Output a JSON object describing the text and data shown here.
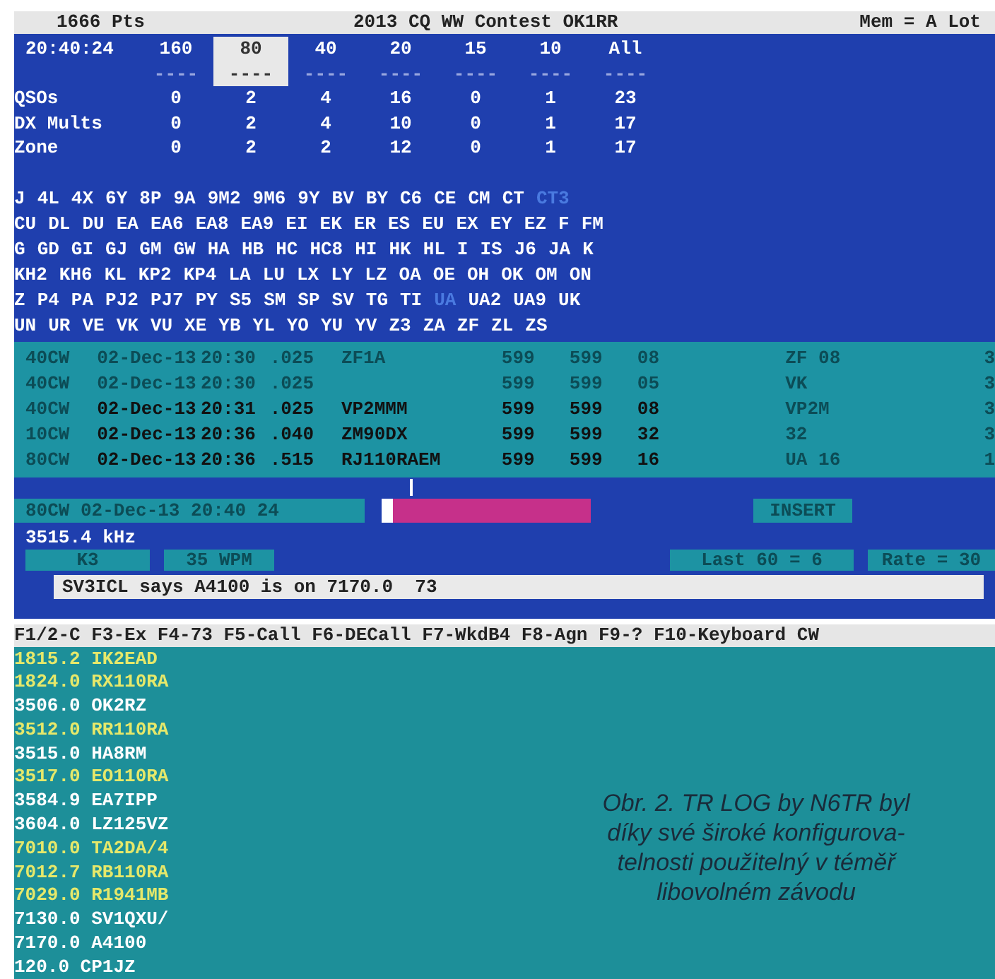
{
  "header": {
    "score": "1666 Pts",
    "title": "2013 CQ WW Contest OK1RR",
    "memory": "Mem = A Lot"
  },
  "stats": {
    "time": "20:40:24",
    "bands": [
      {
        "label": "160",
        "dashes": "----",
        "selected": false
      },
      {
        "label": "80",
        "dashes": "----",
        "selected": true
      },
      {
        "label": "40",
        "dashes": "----",
        "selected": false
      },
      {
        "label": "20",
        "dashes": "----",
        "selected": false
      },
      {
        "label": "15",
        "dashes": "----",
        "selected": false
      },
      {
        "label": "10",
        "dashes": "----",
        "selected": false
      },
      {
        "label": "All",
        "dashes": "----",
        "selected": false
      }
    ],
    "rows": [
      {
        "label": "QSOs",
        "values": [
          "0",
          "2",
          "4",
          "16",
          "0",
          "1",
          "23"
        ]
      },
      {
        "label": "DX Mults",
        "values": [
          "0",
          "2",
          "4",
          "10",
          "0",
          "1",
          "17"
        ]
      },
      {
        "label": "Zone",
        "values": [
          "0",
          "2",
          "2",
          "12",
          "0",
          "1",
          "17"
        ]
      }
    ]
  },
  "multipliers": [
    [
      {
        "text": "J",
        "worked": false
      },
      {
        "text": "4L",
        "worked": false
      },
      {
        "text": "4X",
        "worked": false
      },
      {
        "text": "6Y",
        "worked": false
      },
      {
        "text": "8P",
        "worked": false
      },
      {
        "text": "9A",
        "worked": false
      },
      {
        "text": "9M2",
        "worked": false
      },
      {
        "text": "9M6",
        "worked": false
      },
      {
        "text": "9Y",
        "worked": false
      },
      {
        "text": "BV",
        "worked": false
      },
      {
        "text": "BY",
        "worked": false
      },
      {
        "text": "C6",
        "worked": false
      },
      {
        "text": "CE",
        "worked": false
      },
      {
        "text": "CM",
        "worked": false
      },
      {
        "text": "CT",
        "worked": false
      },
      {
        "text": "CT3",
        "worked": true
      }
    ],
    [
      {
        "text": "CU",
        "worked": false
      },
      {
        "text": "DL",
        "worked": false
      },
      {
        "text": "DU",
        "worked": false
      },
      {
        "text": "EA",
        "worked": false
      },
      {
        "text": "EA6",
        "worked": false
      },
      {
        "text": "EA8",
        "worked": false
      },
      {
        "text": "EA9",
        "worked": false
      },
      {
        "text": "EI",
        "worked": false
      },
      {
        "text": "EK",
        "worked": false
      },
      {
        "text": "ER",
        "worked": false
      },
      {
        "text": "ES",
        "worked": false
      },
      {
        "text": "EU",
        "worked": false
      },
      {
        "text": "EX",
        "worked": false
      },
      {
        "text": "EY",
        "worked": false
      },
      {
        "text": "EZ",
        "worked": false
      },
      {
        "text": "F",
        "worked": false
      },
      {
        "text": "FM",
        "worked": false
      }
    ],
    [
      {
        "text": "G",
        "worked": false
      },
      {
        "text": "GD",
        "worked": false
      },
      {
        "text": "GI",
        "worked": false
      },
      {
        "text": "GJ",
        "worked": false
      },
      {
        "text": "GM",
        "worked": false
      },
      {
        "text": "GW",
        "worked": false
      },
      {
        "text": "HA",
        "worked": false
      },
      {
        "text": "HB",
        "worked": false
      },
      {
        "text": "HC",
        "worked": false
      },
      {
        "text": "HC8",
        "worked": false
      },
      {
        "text": "HI",
        "worked": false
      },
      {
        "text": "HK",
        "worked": false
      },
      {
        "text": "HL",
        "worked": false
      },
      {
        "text": "I",
        "worked": false
      },
      {
        "text": "IS",
        "worked": false
      },
      {
        "text": "J6",
        "worked": false
      },
      {
        "text": "JA",
        "worked": false
      },
      {
        "text": "K",
        "worked": false
      }
    ],
    [
      {
        "text": "KH2",
        "worked": false
      },
      {
        "text": "KH6",
        "worked": false
      },
      {
        "text": "KL",
        "worked": false
      },
      {
        "text": "KP2",
        "worked": false
      },
      {
        "text": "KP4",
        "worked": false
      },
      {
        "text": "LA",
        "worked": false
      },
      {
        "text": "LU",
        "worked": false
      },
      {
        "text": "LX",
        "worked": false
      },
      {
        "text": "LY",
        "worked": false
      },
      {
        "text": "LZ",
        "worked": false
      },
      {
        "text": "OA",
        "worked": false
      },
      {
        "text": "OE",
        "worked": false
      },
      {
        "text": "OH",
        "worked": false
      },
      {
        "text": "OK",
        "worked": false
      },
      {
        "text": "OM",
        "worked": false
      },
      {
        "text": "ON",
        "worked": false
      }
    ],
    [
      {
        "text": "Z",
        "worked": false
      },
      {
        "text": "P4",
        "worked": false
      },
      {
        "text": "PA",
        "worked": false
      },
      {
        "text": "PJ2",
        "worked": false
      },
      {
        "text": "PJ7",
        "worked": false
      },
      {
        "text": "PY",
        "worked": false
      },
      {
        "text": "S5",
        "worked": false
      },
      {
        "text": "SM",
        "worked": false
      },
      {
        "text": "SP",
        "worked": false
      },
      {
        "text": "SV",
        "worked": false
      },
      {
        "text": "TG",
        "worked": false
      },
      {
        "text": "TI",
        "worked": false
      },
      {
        "text": "UA",
        "worked": true
      },
      {
        "text": "UA2",
        "worked": false
      },
      {
        "text": "UA9",
        "worked": false
      },
      {
        "text": "UK",
        "worked": false
      }
    ],
    [
      {
        "text": "UN",
        "worked": false
      },
      {
        "text": "UR",
        "worked": false
      },
      {
        "text": "VE",
        "worked": false
      },
      {
        "text": "VK",
        "worked": false
      },
      {
        "text": "VU",
        "worked": false
      },
      {
        "text": "XE",
        "worked": false
      },
      {
        "text": "YB",
        "worked": false
      },
      {
        "text": "YL",
        "worked": false
      },
      {
        "text": "YO",
        "worked": false
      },
      {
        "text": "YU",
        "worked": false
      },
      {
        "text": "YV",
        "worked": false
      },
      {
        "text": "Z3",
        "worked": false
      },
      {
        "text": "ZA",
        "worked": false
      },
      {
        "text": "ZF",
        "worked": false
      },
      {
        "text": "ZL",
        "worked": false
      },
      {
        "text": "ZS",
        "worked": false
      }
    ]
  ],
  "log": [
    {
      "band": "40CW",
      "date": "02-Dec-13",
      "time": "20:30",
      "freq": ".025",
      "call": "ZF1A",
      "sent": "599",
      "rcvd": "599",
      "zone": "08",
      "mult": "ZF 08",
      "points": "3",
      "dim": true
    },
    {
      "band": "40CW",
      "date": "02-Dec-13",
      "time": "20:30",
      "freq": ".025",
      "sent": "599",
      "rcvd": "599",
      "zone": "05",
      "mult": "VK",
      "points": "3",
      "dim": true
    },
    {
      "band": "40CW",
      "date": "02-Dec-13",
      "time": "20:31",
      "freq": ".025",
      "call": "VP2MMM",
      "sent": "599",
      "rcvd": "599",
      "zone": "08",
      "mult": "VP2M",
      "points": "3",
      "dim": false
    },
    {
      "band": "10CW",
      "date": "02-Dec-13",
      "time": "20:36",
      "freq": ".040",
      "call": "ZM90DX",
      "sent": "599",
      "rcvd": "599",
      "zone": "32",
      "mult": "32",
      "points": "3",
      "dim": false
    },
    {
      "band": "80CW",
      "date": "02-Dec-13",
      "time": "20:36",
      "freq": ".515",
      "call": "RJ110RAEM",
      "sent": "599",
      "rcvd": "599",
      "zone": "16",
      "mult": "UA 16",
      "points": "1",
      "dim": false
    }
  ],
  "entry": {
    "band": "80CW",
    "date": "02-Dec-13",
    "time": "20:40",
    "number": "24",
    "mode": "INSERT"
  },
  "frequency": "3515.4 kHz",
  "status": {
    "radio": "K3",
    "speed": "35 WPM",
    "last60": "Last 60 = 6",
    "rate": "Rate = 30"
  },
  "message": "SV3ICL says A4100 is on 7170.0  73",
  "function_keys": "F1/2-C F3-Ex F4-73 F5-Call F6-DECall F7-WkdB4 F8-Agn F9-? F10-Keyboard CW",
  "bandmap": [
    {
      "freq": "1815.2",
      "call": "IK2EAD",
      "new": true
    },
    {
      "freq": "1824.0",
      "call": "RX110RA",
      "new": true
    },
    {
      "freq": "3506.0",
      "call": "OK2RZ",
      "new": false
    },
    {
      "freq": "3512.0",
      "call": "RR110RA",
      "new": true
    },
    {
      "freq": "3515.0",
      "call": "HA8RM",
      "new": false
    },
    {
      "freq": "3517.0",
      "call": "EO110RA",
      "new": true
    },
    {
      "freq": "3584.9",
      "call": "EA7IPP",
      "new": false
    },
    {
      "freq": "3604.0",
      "call": "LZ125VZ",
      "new": false
    },
    {
      "freq": "7010.0",
      "call": "TA2DA/4",
      "new": true
    },
    {
      "freq": "7012.7",
      "call": "RB110RA",
      "new": true
    },
    {
      "freq": "7029.0",
      "call": "R1941MB",
      "new": true
    },
    {
      "freq": "7130.0",
      "call": "SV1QXU/",
      "new": false
    },
    {
      "freq": "7170.0",
      "call": "A4100",
      "new": false
    },
    {
      "freq": "120.0",
      "call": "CP1JZ",
      "new": false
    }
  ],
  "caption": "Obr. 2. TR LOG by N6TR byl díky své široké konfigurova-telnosti použitelný v téměř libovolném závodu"
}
